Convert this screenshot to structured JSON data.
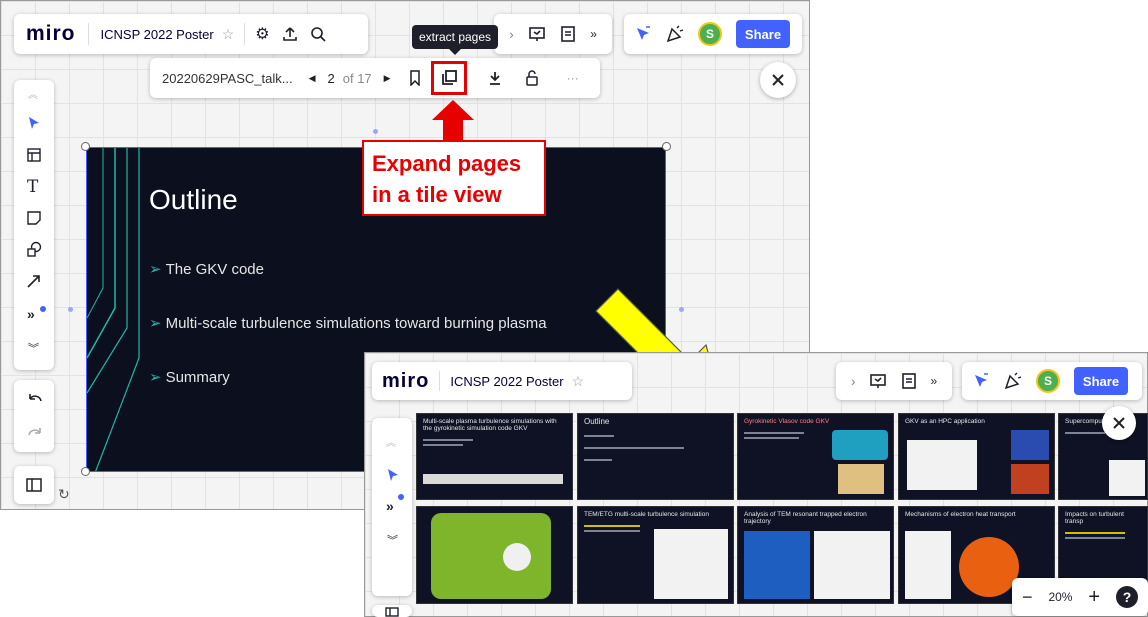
{
  "app": {
    "logo": "miro",
    "board_title": "ICNSP 2022 Poster"
  },
  "toolbar": {
    "share_label": "Share",
    "avatar_initial": "S"
  },
  "tooltip": {
    "text": "extract pages"
  },
  "pdf_toolbar": {
    "filename": "20220629PASC_talk...",
    "current_page": "2",
    "total_pages": "of 17"
  },
  "callout": {
    "line1": "Expand pages",
    "line2": "in a tile view"
  },
  "slide": {
    "title": "Outline",
    "bullets": [
      "The GKV code",
      "Multi-scale turbulence simulations toward burning plasma",
      "Summary"
    ],
    "bullet_marker": "➢"
  },
  "zoom": {
    "level": "20%",
    "minus": "−",
    "plus": "+",
    "help": "?"
  },
  "thumbnails": [
    {
      "title": "Multi-scale plasma turbulence simulations with the gyrokinetic simulation code GKV"
    },
    {
      "title": "Outline"
    },
    {
      "title": "Gyrokinetic Vlasov code GKV"
    },
    {
      "title": "GKV as an HPC application"
    },
    {
      "title": "Supercomputing"
    },
    {
      "title": ""
    },
    {
      "title": "TEM/ETG multi-scale turbulence simulation"
    },
    {
      "title": "Analysis of TEM resonant trapped electron trajectory"
    },
    {
      "title": "Mechanisms of electron heat transport"
    },
    {
      "title": "Impacts on turbulent transp"
    }
  ],
  "colors": {
    "accent": "#4262ff",
    "callout_red": "#e60000",
    "arrow_yellow": "#ffff00",
    "slide_bg": "#0b0f1e"
  },
  "icons": [
    "star-icon",
    "settings-icon",
    "upload-icon",
    "search-icon",
    "present-icon",
    "notes-icon",
    "chevron-down-icon",
    "reactions-icon",
    "celebrate-icon",
    "close-icon",
    "bookmark-icon",
    "extract-pages-icon",
    "download-icon",
    "lock-icon",
    "more-icon",
    "cursor-icon",
    "template-icon",
    "text-icon",
    "sticky-note-icon",
    "shapes-icon",
    "connector-icon",
    "more-tools-icon",
    "undo-icon",
    "redo-icon",
    "frames-panel-icon"
  ]
}
